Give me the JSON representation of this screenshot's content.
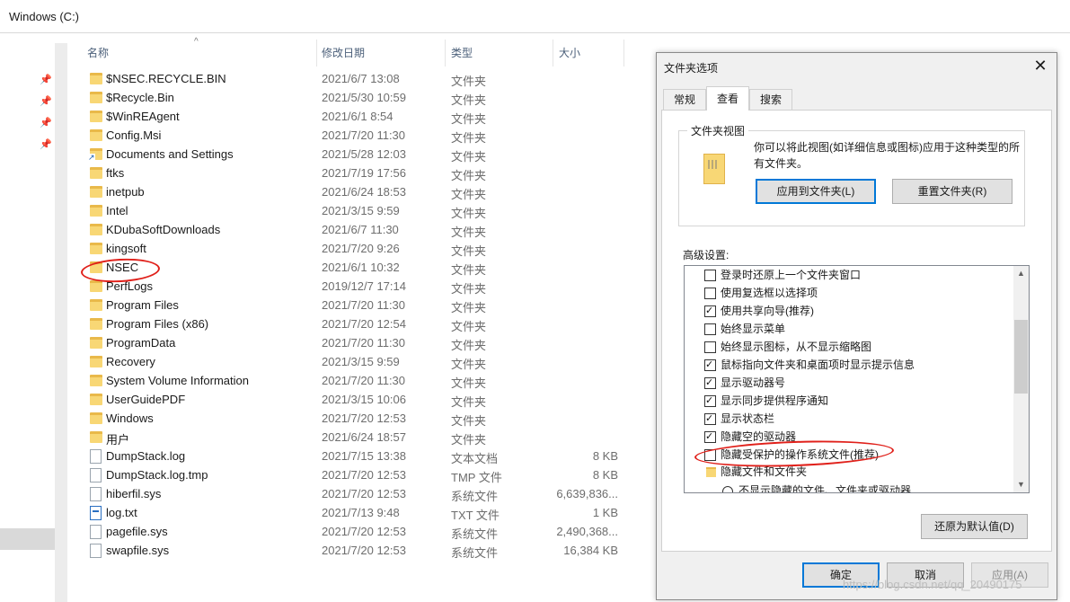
{
  "address": {
    "path": "Windows (C:)"
  },
  "columns": {
    "name": "名称",
    "date": "修改日期",
    "type": "类型",
    "size": "大小"
  },
  "files": [
    {
      "name": "$NSEC.RECYCLE.BIN",
      "date": "2021/6/7 13:08",
      "type": "文件夹",
      "size": "",
      "icon": "folder-icon"
    },
    {
      "name": "$Recycle.Bin",
      "date": "2021/5/30 10:59",
      "type": "文件夹",
      "size": "",
      "icon": "folder-icon"
    },
    {
      "name": "$WinREAgent",
      "date": "2021/6/1 8:54",
      "type": "文件夹",
      "size": "",
      "icon": "folder-icon"
    },
    {
      "name": "Config.Msi",
      "date": "2021/7/20 11:30",
      "type": "文件夹",
      "size": "",
      "icon": "folder-icon"
    },
    {
      "name": "Documents and Settings",
      "date": "2021/5/28 12:03",
      "type": "文件夹",
      "size": "",
      "icon": "folder-shortcut-icon"
    },
    {
      "name": "ftks",
      "date": "2021/7/19 17:56",
      "type": "文件夹",
      "size": "",
      "icon": "folder-icon"
    },
    {
      "name": "inetpub",
      "date": "2021/6/24 18:53",
      "type": "文件夹",
      "size": "",
      "icon": "folder-icon"
    },
    {
      "name": "Intel",
      "date": "2021/3/15 9:59",
      "type": "文件夹",
      "size": "",
      "icon": "folder-icon"
    },
    {
      "name": "KDubaSoftDownloads",
      "date": "2021/6/7 11:30",
      "type": "文件夹",
      "size": "",
      "icon": "folder-icon"
    },
    {
      "name": "kingsoft",
      "date": "2021/7/20 9:26",
      "type": "文件夹",
      "size": "",
      "icon": "folder-icon"
    },
    {
      "name": "NSEC",
      "date": "2021/6/1 10:32",
      "type": "文件夹",
      "size": "",
      "icon": "folder-icon"
    },
    {
      "name": "PerfLogs",
      "date": "2019/12/7 17:14",
      "type": "文件夹",
      "size": "",
      "icon": "folder-icon"
    },
    {
      "name": "Program Files",
      "date": "2021/7/20 11:30",
      "type": "文件夹",
      "size": "",
      "icon": "folder-icon"
    },
    {
      "name": "Program Files (x86)",
      "date": "2021/7/20 12:54",
      "type": "文件夹",
      "size": "",
      "icon": "folder-icon"
    },
    {
      "name": "ProgramData",
      "date": "2021/7/20 11:30",
      "type": "文件夹",
      "size": "",
      "icon": "folder-icon"
    },
    {
      "name": "Recovery",
      "date": "2021/3/15 9:59",
      "type": "文件夹",
      "size": "",
      "icon": "folder-icon"
    },
    {
      "name": "System Volume Information",
      "date": "2021/7/20 11:30",
      "type": "文件夹",
      "size": "",
      "icon": "folder-icon"
    },
    {
      "name": "UserGuidePDF",
      "date": "2021/3/15 10:06",
      "type": "文件夹",
      "size": "",
      "icon": "folder-icon"
    },
    {
      "name": "Windows",
      "date": "2021/7/20 12:53",
      "type": "文件夹",
      "size": "",
      "icon": "folder-icon"
    },
    {
      "name": "用户",
      "date": "2021/6/24 18:57",
      "type": "文件夹",
      "size": "",
      "icon": "folder-icon"
    },
    {
      "name": "DumpStack.log",
      "date": "2021/7/15 13:38",
      "type": "文本文档",
      "size": "8 KB",
      "icon": "file-icon"
    },
    {
      "name": "DumpStack.log.tmp",
      "date": "2021/7/20 12:53",
      "type": "TMP 文件",
      "size": "8 KB",
      "icon": "file-icon"
    },
    {
      "name": "hiberfil.sys",
      "date": "2021/7/20 12:53",
      "type": "系统文件",
      "size": "6,639,836...",
      "icon": "file-icon"
    },
    {
      "name": "log.txt",
      "date": "2021/7/13 9:48",
      "type": "TXT 文件",
      "size": "1 KB",
      "icon": "text-file-icon"
    },
    {
      "name": "pagefile.sys",
      "date": "2021/7/20 12:53",
      "type": "系统文件",
      "size": "2,490,368...",
      "icon": "file-icon"
    },
    {
      "name": "swapfile.sys",
      "date": "2021/7/20 12:53",
      "type": "系统文件",
      "size": "16,384 KB",
      "icon": "file-icon"
    }
  ],
  "dialog": {
    "title": "文件夹选项",
    "tabs": [
      "常规",
      "查看",
      "搜索"
    ],
    "active_tab": "查看",
    "folder_view_group": "文件夹视图",
    "folder_view_desc": "你可以将此视图(如详细信息或图标)应用于这种类型的所有文件夹。",
    "apply_to_folders": "应用到文件夹(L)",
    "reset_folders": "重置文件夹(R)",
    "advanced_label": "高级设置:",
    "options": [
      {
        "label": "登录时还原上一个文件夹窗口",
        "checked": false
      },
      {
        "label": "使用复选框以选择项",
        "checked": false
      },
      {
        "label": "使用共享向导(推荐)",
        "checked": true
      },
      {
        "label": "始终显示菜单",
        "checked": false
      },
      {
        "label": "始终显示图标，从不显示缩略图",
        "checked": false
      },
      {
        "label": "鼠标指向文件夹和桌面项时显示提示信息",
        "checked": true
      },
      {
        "label": "显示驱动器号",
        "checked": true
      },
      {
        "label": "显示同步提供程序通知",
        "checked": true
      },
      {
        "label": "显示状态栏",
        "checked": true
      },
      {
        "label": "隐藏空的驱动器",
        "checked": true
      },
      {
        "label": "隐藏受保护的操作系统文件(推荐)",
        "checked": false
      }
    ],
    "hidden_files_group": "隐藏文件和文件夹",
    "hidden_files_radio": "不显示隐藏的文件、文件夹或驱动器",
    "restore_defaults": "还原为默认值(D)",
    "ok": "确定",
    "cancel": "取消",
    "apply": "应用(A)"
  },
  "watermark": "https://blog.csdn.net/qq_20490175"
}
